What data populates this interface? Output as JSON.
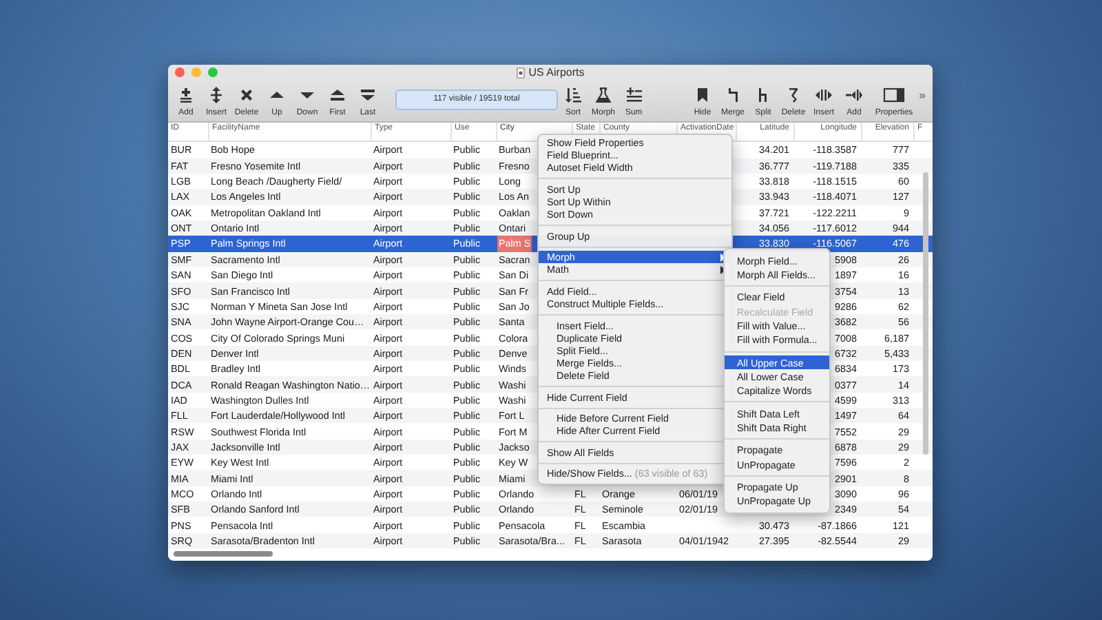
{
  "window": {
    "title": "US Airports"
  },
  "toolbar": {
    "left": [
      "Add",
      "Insert",
      "Delete",
      "Up",
      "Down",
      "First",
      "Last"
    ],
    "status": "117 visible / 19519 total",
    "middle": [
      "Sort",
      "Morph",
      "Sum"
    ],
    "right": [
      "Hide",
      "Merge",
      "Split",
      "Delete",
      "Insert",
      "Add",
      "Properties"
    ],
    "overflow": "»"
  },
  "table": {
    "columns": [
      {
        "label": "ID",
        "current": false
      },
      {
        "label": "FacilityName",
        "current": false
      },
      {
        "label": "Type",
        "current": false
      },
      {
        "label": "Use",
        "current": false
      },
      {
        "label": "City",
        "current": true
      },
      {
        "label": "State",
        "current": false
      },
      {
        "label": "County",
        "current": false
      },
      {
        "label": "ActivationDate",
        "current": false
      },
      {
        "label": "Latitude",
        "current": false
      },
      {
        "label": "Longitude",
        "current": false
      },
      {
        "label": "Elevation",
        "current": false
      },
      {
        "label": "F",
        "current": false
      }
    ],
    "rows": [
      {
        "selected": false,
        "cells": [
          "BUR",
          "Bob Hope",
          "Airport",
          "Public",
          "Burban",
          null,
          null,
          null,
          "34.201",
          "-118.3587",
          "777"
        ]
      },
      {
        "selected": false,
        "cells": [
          "FAT",
          "Fresno Yosemite Intl",
          "Airport",
          "Public",
          "Fresno",
          null,
          null,
          null,
          "36.777",
          "-119.7188",
          "335"
        ]
      },
      {
        "selected": false,
        "cells": [
          "LGB",
          "Long Beach /Daugherty Field/",
          "Airport",
          "Public",
          "Long",
          null,
          null,
          null,
          "33.818",
          "-118.1515",
          "60"
        ]
      },
      {
        "selected": false,
        "cells": [
          "LAX",
          "Los Angeles Intl",
          "Airport",
          "Public",
          "Los An",
          null,
          null,
          null,
          "33.943",
          "-118.4071",
          "127"
        ]
      },
      {
        "selected": false,
        "cells": [
          "OAK",
          "Metropolitan Oakland Intl",
          "Airport",
          "Public",
          "Oaklan",
          null,
          null,
          null,
          "37.721",
          "-122.2211",
          "9"
        ]
      },
      {
        "selected": false,
        "cells": [
          "ONT",
          "Ontario Intl",
          "Airport",
          "Public",
          "Ontari",
          null,
          null,
          null,
          "34.056",
          "-117.6012",
          "944"
        ]
      },
      {
        "selected": true,
        "cells": [
          "PSP",
          "Palm Springs Intl",
          "Airport",
          "Public",
          "Palm S",
          null,
          null,
          null,
          "33.830",
          "-116.5067",
          "476"
        ]
      },
      {
        "selected": false,
        "cells": [
          "SMF",
          "Sacramento Intl",
          "Airport",
          "Public",
          "Sacran",
          null,
          null,
          null,
          null,
          "5908",
          "26"
        ]
      },
      {
        "selected": false,
        "cells": [
          "SAN",
          "San Diego Intl",
          "Airport",
          "Public",
          "San Di",
          null,
          null,
          null,
          null,
          "1897",
          "16"
        ]
      },
      {
        "selected": false,
        "cells": [
          "SFO",
          "San Francisco Intl",
          "Airport",
          "Public",
          "San Fr",
          null,
          null,
          null,
          null,
          "3754",
          "13"
        ]
      },
      {
        "selected": false,
        "cells": [
          "SJC",
          "Norman Y Mineta San Jose Intl",
          "Airport",
          "Public",
          "San Jo",
          null,
          null,
          null,
          null,
          "9286",
          "62"
        ]
      },
      {
        "selected": false,
        "cells": [
          "SNA",
          "John Wayne Airport-Orange Cou…",
          "Airport",
          "Public",
          "Santa",
          null,
          null,
          null,
          null,
          "3682",
          "56"
        ]
      },
      {
        "selected": false,
        "cells": [
          "COS",
          "City Of Colorado Springs Muni",
          "Airport",
          "Public",
          "Colora",
          null,
          null,
          null,
          null,
          "7008",
          "6,187"
        ]
      },
      {
        "selected": false,
        "cells": [
          "DEN",
          "Denver Intl",
          "Airport",
          "Public",
          "Denve",
          null,
          null,
          null,
          null,
          "6732",
          "5,433"
        ]
      },
      {
        "selected": false,
        "cells": [
          "BDL",
          "Bradley Intl",
          "Airport",
          "Public",
          "Winds",
          null,
          null,
          null,
          null,
          "6834",
          "173"
        ]
      },
      {
        "selected": false,
        "cells": [
          "DCA",
          "Ronald Reagan Washington Natio…",
          "Airport",
          "Public",
          "Washi",
          null,
          null,
          null,
          null,
          "0377",
          "14"
        ]
      },
      {
        "selected": false,
        "cells": [
          "IAD",
          "Washington Dulles Intl",
          "Airport",
          "Public",
          "Washi",
          null,
          null,
          null,
          null,
          "4599",
          "313"
        ]
      },
      {
        "selected": false,
        "cells": [
          "FLL",
          "Fort Lauderdale/Hollywood Intl",
          "Airport",
          "Public",
          "Fort L",
          null,
          null,
          null,
          null,
          "1497",
          "64"
        ]
      },
      {
        "selected": false,
        "cells": [
          "RSW",
          "Southwest Florida Intl",
          "Airport",
          "Public",
          "Fort M",
          null,
          null,
          null,
          null,
          "7552",
          "29"
        ]
      },
      {
        "selected": false,
        "cells": [
          "JAX",
          "Jacksonville Intl",
          "Airport",
          "Public",
          "Jackso",
          null,
          null,
          null,
          null,
          "6878",
          "29"
        ]
      },
      {
        "selected": false,
        "cells": [
          "EYW",
          "Key West Intl",
          "Airport",
          "Public",
          "Key W",
          null,
          null,
          null,
          null,
          "7596",
          "2"
        ]
      },
      {
        "selected": false,
        "cells": [
          "MIA",
          "Miami Intl",
          "Airport",
          "Public",
          "Miami",
          null,
          null,
          null,
          null,
          "2901",
          "8"
        ]
      },
      {
        "selected": false,
        "cells": [
          "MCO",
          "Orlando Intl",
          "Airport",
          "Public",
          "Orlando",
          "FL",
          "Orange",
          "06/01/19",
          null,
          "3090",
          "96"
        ]
      },
      {
        "selected": false,
        "cells": [
          "SFB",
          "Orlando Sanford Intl",
          "Airport",
          "Public",
          "Orlando",
          "FL",
          "Seminole",
          "02/01/19",
          null,
          "2349",
          "54"
        ]
      },
      {
        "selected": false,
        "cells": [
          "PNS",
          "Pensacola Intl",
          "Airport",
          "Public",
          "Pensacola",
          "FL",
          "Escambia",
          null,
          "30.473",
          "-87.1866",
          "121"
        ]
      },
      {
        "selected": false,
        "cells": [
          "SRQ",
          "Sarasota/Bradenton Intl",
          "Airport",
          "Public",
          "Sarasota/Bra...",
          "FL",
          "Sarasota",
          "04/01/1942",
          "27.395",
          "-82.5544",
          "29"
        ]
      }
    ]
  },
  "field_menu": {
    "groups": [
      {
        "items": [
          {
            "label": "Show Field Properties",
            "indented": false,
            "selected": false,
            "submenu": false
          },
          {
            "label": "Field Blueprint...",
            "indented": false,
            "selected": false,
            "submenu": false
          },
          {
            "label": "Autoset Field Width",
            "indented": false,
            "selected": false,
            "submenu": false
          }
        ]
      },
      {
        "items": [
          {
            "label": "Sort Up",
            "indented": false,
            "selected": false,
            "submenu": false
          },
          {
            "label": "Sort Up Within",
            "indented": false,
            "selected": false,
            "submenu": false
          },
          {
            "label": "Sort Down",
            "indented": false,
            "selected": false,
            "submenu": false
          }
        ]
      },
      {
        "items": [
          {
            "label": "Group Up",
            "indented": false,
            "selected": false,
            "submenu": false
          }
        ]
      },
      {
        "items": [
          {
            "label": "Morph",
            "indented": false,
            "selected": true,
            "submenu": true
          },
          {
            "label": "Math",
            "indented": false,
            "selected": false,
            "submenu": true
          }
        ]
      },
      {
        "items": [
          {
            "label": "Add Field...",
            "indented": false,
            "selected": false,
            "submenu": false
          },
          {
            "label": "Construct Multiple Fields...",
            "indented": false,
            "selected": false,
            "submenu": false
          }
        ]
      },
      {
        "items": [
          {
            "label": "Insert Field...",
            "indented": true,
            "selected": false,
            "submenu": false
          },
          {
            "label": "Duplicate Field",
            "indented": true,
            "selected": false,
            "submenu": false
          },
          {
            "label": "Split Field...",
            "indented": true,
            "selected": false,
            "submenu": false
          },
          {
            "label": "Merge Fields...",
            "indented": true,
            "selected": false,
            "submenu": false
          },
          {
            "label": "Delete Field",
            "indented": true,
            "selected": false,
            "submenu": false
          }
        ]
      },
      {
        "items": [
          {
            "label": "Hide Current Field",
            "indented": false,
            "selected": false,
            "submenu": false
          }
        ]
      },
      {
        "items": [
          {
            "label": "Hide Before Current Field",
            "indented": true,
            "selected": false,
            "submenu": false
          },
          {
            "label": "Hide After Current Field",
            "indented": true,
            "selected": false,
            "submenu": false
          }
        ]
      },
      {
        "items": [
          {
            "label": "Show All Fields",
            "indented": false,
            "selected": false,
            "submenu": false
          }
        ]
      },
      {
        "items": [
          {
            "label": "Hide/Show Fields...",
            "note": "(63 visible of 63)",
            "indented": false,
            "selected": false,
            "submenu": false
          }
        ]
      }
    ]
  },
  "morph_submenu": {
    "groups": [
      {
        "items": [
          {
            "label": "Morph Field...",
            "selected": false,
            "disabled": false
          },
          {
            "label": "Morph All Fields...",
            "selected": false,
            "disabled": false
          }
        ]
      },
      {
        "items": [
          {
            "label": "Clear Field",
            "selected": false,
            "disabled": false
          },
          {
            "label": "Recalculate Field",
            "selected": false,
            "disabled": true
          },
          {
            "label": "Fill with Value...",
            "selected": false,
            "disabled": false
          },
          {
            "label": "Fill with Formula...",
            "selected": false,
            "disabled": false
          }
        ]
      },
      {
        "items": [
          {
            "label": "All Upper Case",
            "selected": true,
            "disabled": false
          },
          {
            "label": "All Lower Case",
            "selected": false,
            "disabled": false
          },
          {
            "label": "Capitalize Words",
            "selected": false,
            "disabled": false
          }
        ]
      },
      {
        "items": [
          {
            "label": "Shift Data Left",
            "selected": false,
            "disabled": false
          },
          {
            "label": "Shift Data Right",
            "selected": false,
            "disabled": false
          }
        ]
      },
      {
        "items": [
          {
            "label": "Propagate",
            "selected": false,
            "disabled": false
          },
          {
            "label": "UnPropagate",
            "selected": false,
            "disabled": false
          }
        ]
      },
      {
        "items": [
          {
            "label": "Propagate Up",
            "selected": false,
            "disabled": false
          },
          {
            "label": "UnPropagate Up",
            "selected": false,
            "disabled": false
          }
        ]
      }
    ]
  }
}
